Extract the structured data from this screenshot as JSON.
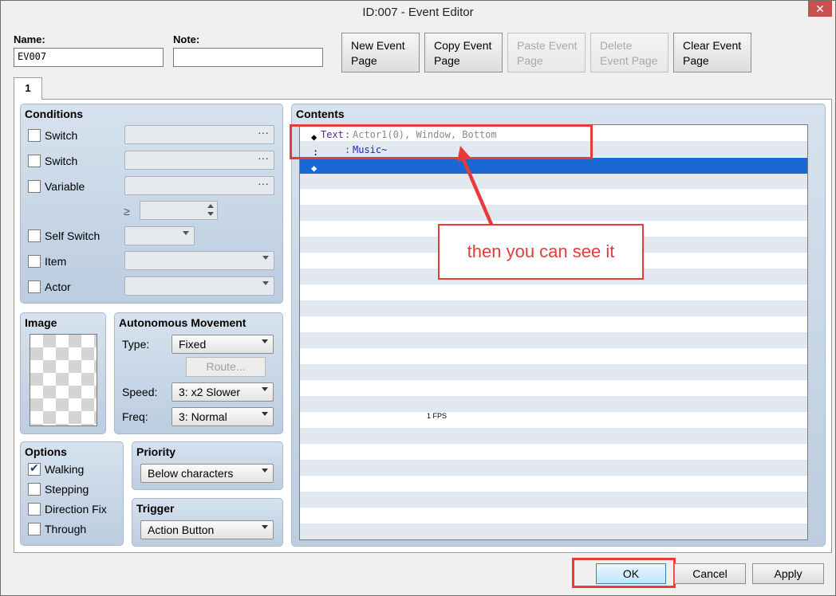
{
  "window": {
    "title": "ID:007 - Event Editor",
    "close_glyph": "✕"
  },
  "name_field": {
    "label": "Name:",
    "value": "EV007"
  },
  "note_field": {
    "label": "Note:",
    "value": ""
  },
  "page_buttons": {
    "new": "New Event Page",
    "copy": "Copy Event Page",
    "paste": "Paste Event Page",
    "delete": "Delete Event Page",
    "clear": "Clear Event Page"
  },
  "tabs": [
    "1"
  ],
  "conditions": {
    "title": "Conditions",
    "switch1": {
      "label": "Switch",
      "checked": false
    },
    "switch2": {
      "label": "Switch",
      "checked": false
    },
    "variable": {
      "label": "Variable",
      "checked": false
    },
    "gte_symbol": "≥",
    "self_switch": {
      "label": "Self Switch",
      "checked": false
    },
    "item": {
      "label": "Item",
      "checked": false
    },
    "actor": {
      "label": "Actor",
      "checked": false
    },
    "ellipsis": "···"
  },
  "image": {
    "title": "Image"
  },
  "autonomous_movement": {
    "title": "Autonomous Movement",
    "type_label": "Type:",
    "type_value": "Fixed",
    "route_label": "Route...",
    "speed_label": "Speed:",
    "speed_value": "3: x2 Slower",
    "freq_label": "Freq:",
    "freq_value": "3: Normal"
  },
  "options": {
    "title": "Options",
    "walking": {
      "label": "Walking",
      "checked": true
    },
    "stepping": {
      "label": "Stepping",
      "checked": false
    },
    "direction_fix": {
      "label": "Direction Fix",
      "checked": false
    },
    "through": {
      "label": "Through",
      "checked": false
    }
  },
  "priority": {
    "title": "Priority",
    "value": "Below characters"
  },
  "trigger": {
    "title": "Trigger",
    "value": "Action Button"
  },
  "contents": {
    "title": "Contents",
    "rows": [
      {
        "marker": "◆",
        "command": "Text",
        "sep": ":",
        "params": "Actor1(0), Window, Bottom"
      },
      {
        "marker": ":",
        "command": "",
        "sep": ":",
        "params": "Music~"
      },
      {
        "marker": "◆",
        "command": "",
        "sep": "",
        "params": ""
      }
    ]
  },
  "overlay": {
    "fps": "1 FPS",
    "annotation": "then you can see it"
  },
  "dialog_buttons": {
    "ok": "OK",
    "cancel": "Cancel",
    "apply": "Apply"
  },
  "colors": {
    "annotation_red": "#e8393b",
    "selection_blue": "#1a68d4",
    "group_blue": "#c8d6e6"
  }
}
